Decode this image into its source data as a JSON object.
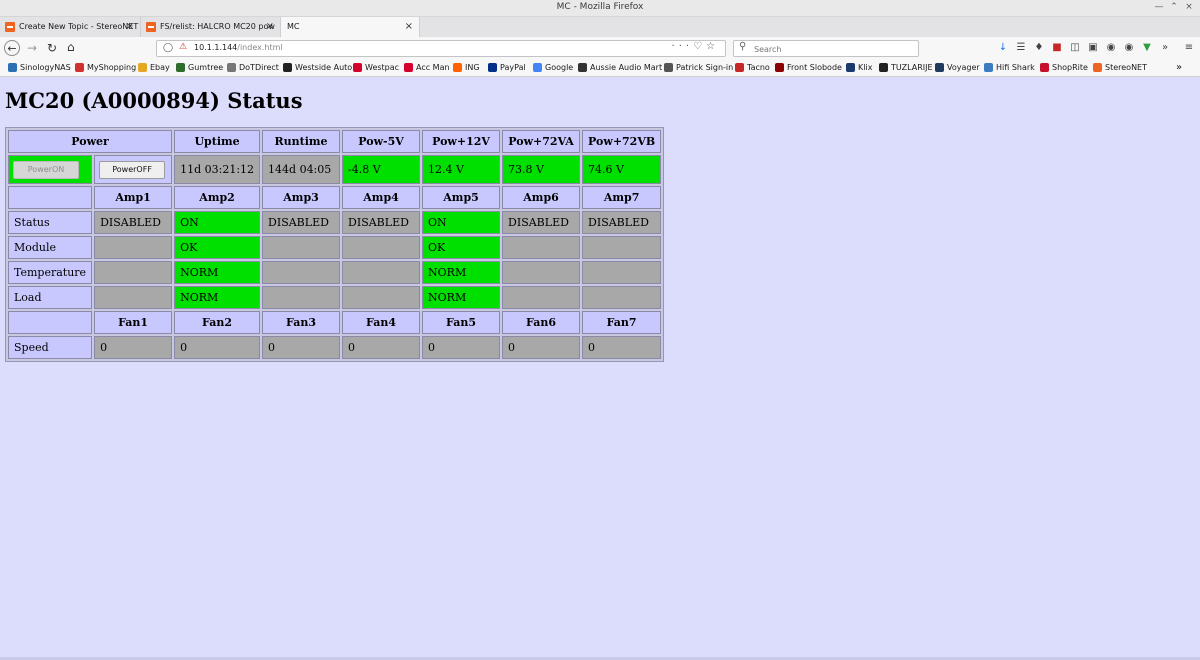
{
  "window": {
    "title": "MC - Mozilla Firefox"
  },
  "tabs": [
    {
      "label": "Create New Topic - StereoNET"
    },
    {
      "label": "FS/relist: HALCRO MC20 pow"
    },
    {
      "label": "MC"
    }
  ],
  "navbar": {
    "url_host": "10.1.1.144",
    "url_path": "/index.html",
    "search_placeholder": "Search"
  },
  "bookmarks": [
    {
      "label": "SinologyNAS",
      "color": "#2d6fb5"
    },
    {
      "label": "MyShopping",
      "color": "#d0312d"
    },
    {
      "label": "Ebay",
      "color": "#e5a823"
    },
    {
      "label": "Gumtree",
      "color": "#2f6d2f"
    },
    {
      "label": "DoTDirect",
      "color": "#777777"
    },
    {
      "label": "Westside Auto",
      "color": "#222222"
    },
    {
      "label": "Westpac",
      "color": "#d5002b"
    },
    {
      "label": "Acc Man",
      "color": "#d5002b"
    },
    {
      "label": "ING",
      "color": "#ff6200"
    },
    {
      "label": "PayPal",
      "color": "#003087"
    },
    {
      "label": "Google",
      "color": "#4285f4"
    },
    {
      "label": "Aussie Audio Mart",
      "color": "#333333"
    },
    {
      "label": "Patrick Sign-in",
      "color": "#555555"
    },
    {
      "label": "Tacno",
      "color": "#c62828"
    },
    {
      "label": "Front Slobode",
      "color": "#8b0000"
    },
    {
      "label": "Klix",
      "color": "#1a3b6e"
    },
    {
      "label": "TUZLARIJE",
      "color": "#222222"
    },
    {
      "label": "Voyager",
      "color": "#1e3a5f"
    },
    {
      "label": "Hifi Shark",
      "color": "#3b7dbf"
    },
    {
      "label": "ShopRite",
      "color": "#c8102e"
    },
    {
      "label": "StereoNET",
      "color": "#ef6421"
    }
  ],
  "page": {
    "title": "MC20 (A0000894) Status"
  },
  "table": {
    "power_header": "Power",
    "top_headers": [
      "Uptime",
      "Runtime",
      "Pow-5V",
      "Pow+12V",
      "Pow+72VA",
      "Pow+72VB"
    ],
    "power_on_label": "PowerON",
    "power_off_label": "PowerOFF",
    "top_values": [
      "11d 03:21:12",
      "144d 04:05",
      "-4.8 V",
      "12.4 V",
      "73.8 V",
      "74.6 V"
    ],
    "amp_headers": [
      "Amp1",
      "Amp2",
      "Amp3",
      "Amp4",
      "Amp5",
      "Amp6",
      "Amp7"
    ],
    "rows": [
      {
        "label": "Status",
        "values": [
          "DISABLED",
          "ON",
          "DISABLED",
          "DISABLED",
          "ON",
          "DISABLED",
          "DISABLED"
        ]
      },
      {
        "label": "Module",
        "values": [
          "",
          "OK",
          "",
          "",
          "OK",
          "",
          ""
        ]
      },
      {
        "label": "Temperature",
        "values": [
          "",
          "NORM",
          "",
          "",
          "NORM",
          "",
          ""
        ]
      },
      {
        "label": "Load",
        "values": [
          "",
          "NORM",
          "",
          "",
          "NORM",
          "",
          ""
        ]
      }
    ],
    "fan_headers": [
      "Fan1",
      "Fan2",
      "Fan3",
      "Fan4",
      "Fan5",
      "Fan6",
      "Fan7"
    ],
    "speed_label": "Speed",
    "speed_values": [
      "0",
      "0",
      "0",
      "0",
      "0",
      "0",
      "0"
    ]
  },
  "colors": {
    "page_bg": "#dcdcfc",
    "header_bg": "#c8c8ff",
    "ok_green": "#00e000",
    "inactive_grey": "#a8a8a8"
  }
}
